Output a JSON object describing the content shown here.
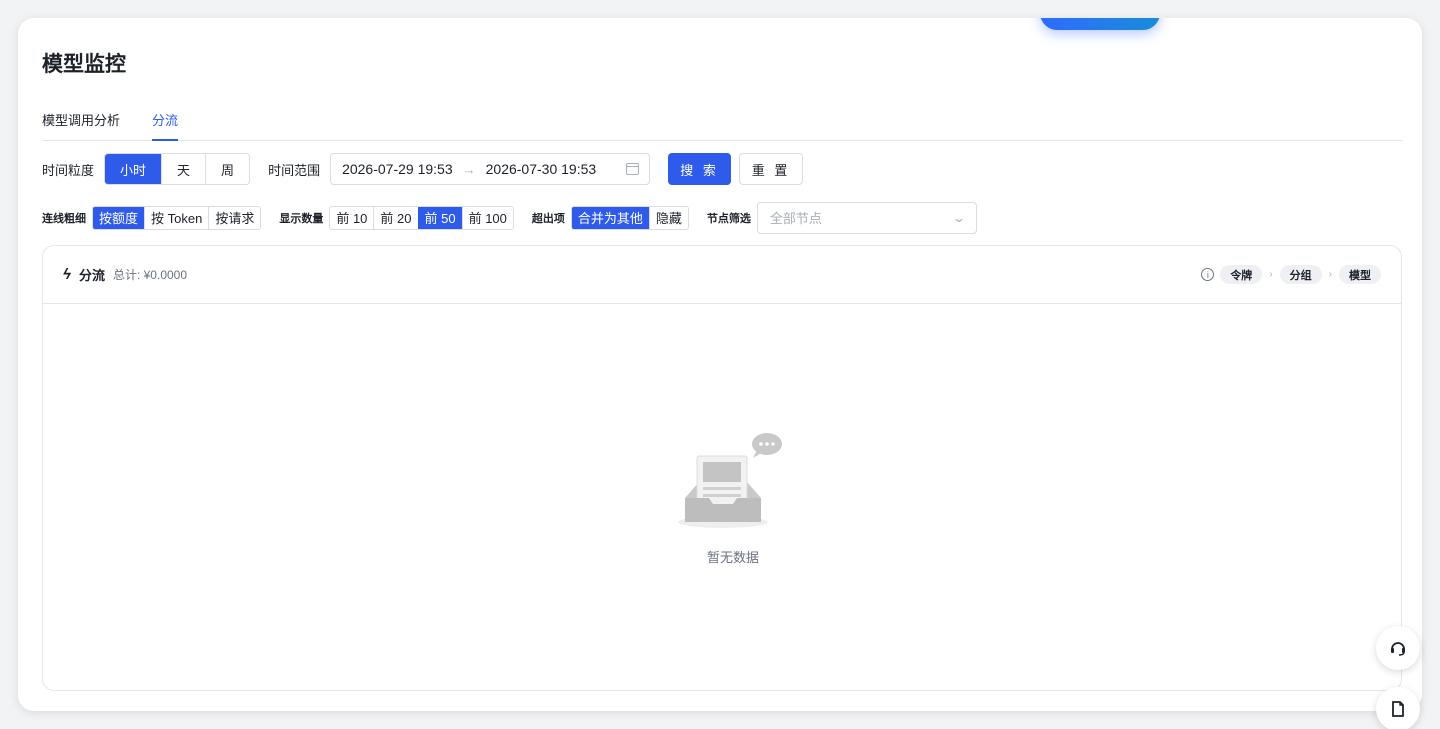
{
  "page": {
    "title": "模型监控"
  },
  "tabs": [
    {
      "label": "模型调用分析",
      "active": false
    },
    {
      "label": "分流",
      "active": true
    }
  ],
  "time_granularity": {
    "label": "时间粒度",
    "options": [
      "小时",
      "天",
      "周"
    ],
    "selected": "小时"
  },
  "time_range": {
    "label": "时间范围",
    "start": "2026-07-29 19:53",
    "arrow": "→",
    "end": "2026-07-30 19:53"
  },
  "actions": {
    "search": "搜 索",
    "reset": "重 置"
  },
  "link_weight": {
    "label": "连线粗细",
    "options": [
      "按额度",
      "按 Token",
      "按请求"
    ],
    "selected": "按额度"
  },
  "display_count": {
    "label": "显示数量",
    "options": [
      "前 10",
      "前 20",
      "前 50",
      "前 100"
    ],
    "selected": "前 50"
  },
  "overflow": {
    "label": "超出项",
    "options": [
      "合并为其他",
      "隐藏"
    ],
    "selected": "合并为其他"
  },
  "node_filter": {
    "label": "节点筛选",
    "placeholder": "全部节点"
  },
  "panel": {
    "title": "分流",
    "total": "总计: ¥0.0000",
    "crumbs": [
      "令牌",
      "分组",
      "模型"
    ]
  },
  "empty": {
    "text": "暂无数据"
  },
  "colors": {
    "primary": "#2f5bea",
    "border": "#d9dce3",
    "text": "#1d2129"
  }
}
